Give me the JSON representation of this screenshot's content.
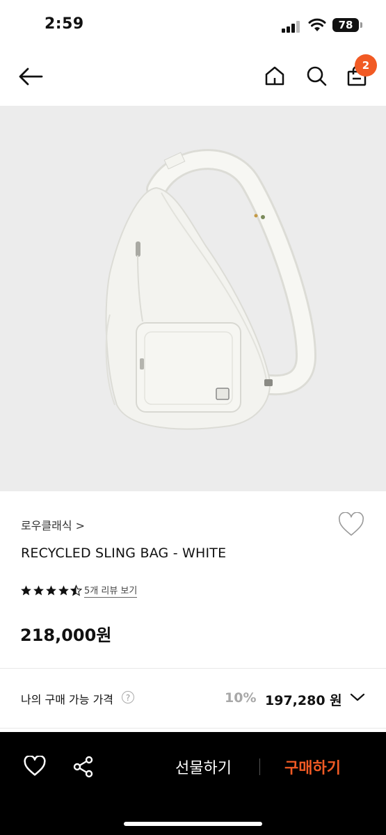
{
  "status_bar": {
    "time": "2:59",
    "battery": "78"
  },
  "header": {
    "cart_count": "2"
  },
  "product": {
    "brand": "로우클래식 >",
    "name": "RECYCLED SLING BAG - WHITE",
    "rating": 4.5,
    "review_link": "5개 리뷰 보기",
    "price": "218,000원"
  },
  "my_price": {
    "label": "나의 구매 가능 가격",
    "help": "?",
    "discount": "10%",
    "value": "197,280 원"
  },
  "bottom_bar": {
    "gift": "선물하기",
    "buy": "구매하기"
  },
  "colors": {
    "accent": "#f15a24",
    "image_bg": "#ececec",
    "bar_bg": "#000000"
  }
}
